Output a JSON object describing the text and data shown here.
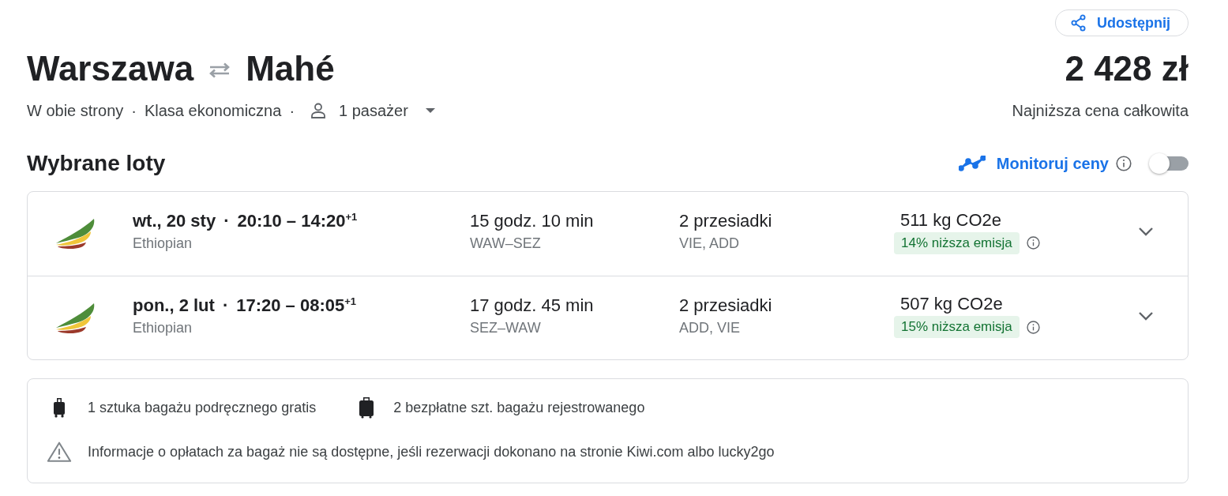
{
  "header": {
    "share_button": "Udostępnij",
    "origin": "Warszawa",
    "destination": "Mahé",
    "price": "2 428 zł",
    "trip_type": "W obie strony",
    "separator_1": "·",
    "cabin_class": "Klasa ekonomiczna",
    "separator_2": "·",
    "passengers": "1 pasażer",
    "price_note": "Najniższa cena całkowita"
  },
  "selected_flights": {
    "title": "Wybrane loty",
    "track_prices": {
      "label": "Monitoruj ceny",
      "on": false
    },
    "flights": [
      {
        "date": "wt., 20 sty",
        "separator": "·",
        "times": "20:10 – 14:20$^{+1}$",
        "airline": "Ethiopian",
        "duration": "15 godz. 10 min",
        "route": "WAW–SEZ",
        "stops": "2 przesiadki",
        "stop_airports": "VIE, ADD",
        "emissions": "511 kg CO2e",
        "emissions_badge": "14% niższa emisja",
        "expanded": false
      },
      {
        "date": "pon., 2 lut",
        "separator": "·",
        "times": "17:20 – 08:05$^{+1}$",
        "airline": "Ethiopian",
        "duration": "17 godz. 45 min",
        "route": "SEZ–WAW",
        "stops": "2 przesiadki",
        "stop_airports": "ADD, VIE",
        "emissions": "507 kg CO2e",
        "emissions_badge": "15% niższa emisja",
        "expanded": false
      }
    ]
  },
  "baggage": {
    "items": [
      {
        "kind": "carry_on",
        "text": "1 sztuka bagażu podręcznego gratis"
      },
      {
        "kind": "checked",
        "text": "2 bezpłatne szt. bagażu rejestrowanego"
      }
    ],
    "notice": "Informacje o opłatach za bagaż nie są dostępne, jeśli rezerwacji dokonano na stronie Kiwi.com albo lucky2go"
  }
}
